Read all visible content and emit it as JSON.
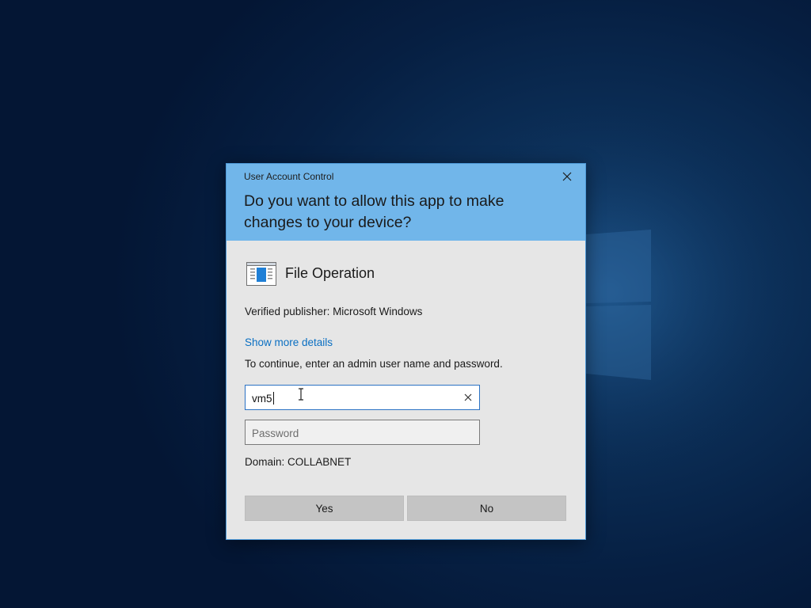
{
  "dialog": {
    "title": "User Account Control",
    "question": "Do you want to allow this app to make changes to your device?",
    "app_icon": "file-operation-icon",
    "app_name": "File Operation",
    "publisher": "Verified publisher: Microsoft Windows",
    "details_link": "Show more details",
    "instruction": "To continue, enter an admin user name and password.",
    "username": {
      "value": "vm5"
    },
    "password": {
      "placeholder": "Password"
    },
    "domain": "Domain: COLLABNET",
    "buttons": {
      "yes": "Yes",
      "no": "No"
    }
  },
  "colors": {
    "header": "#71b6ea",
    "body": "#e6e6e6",
    "link": "#0a6fc2",
    "button": "#c4c4c4",
    "desktop": "#0b2d55"
  }
}
